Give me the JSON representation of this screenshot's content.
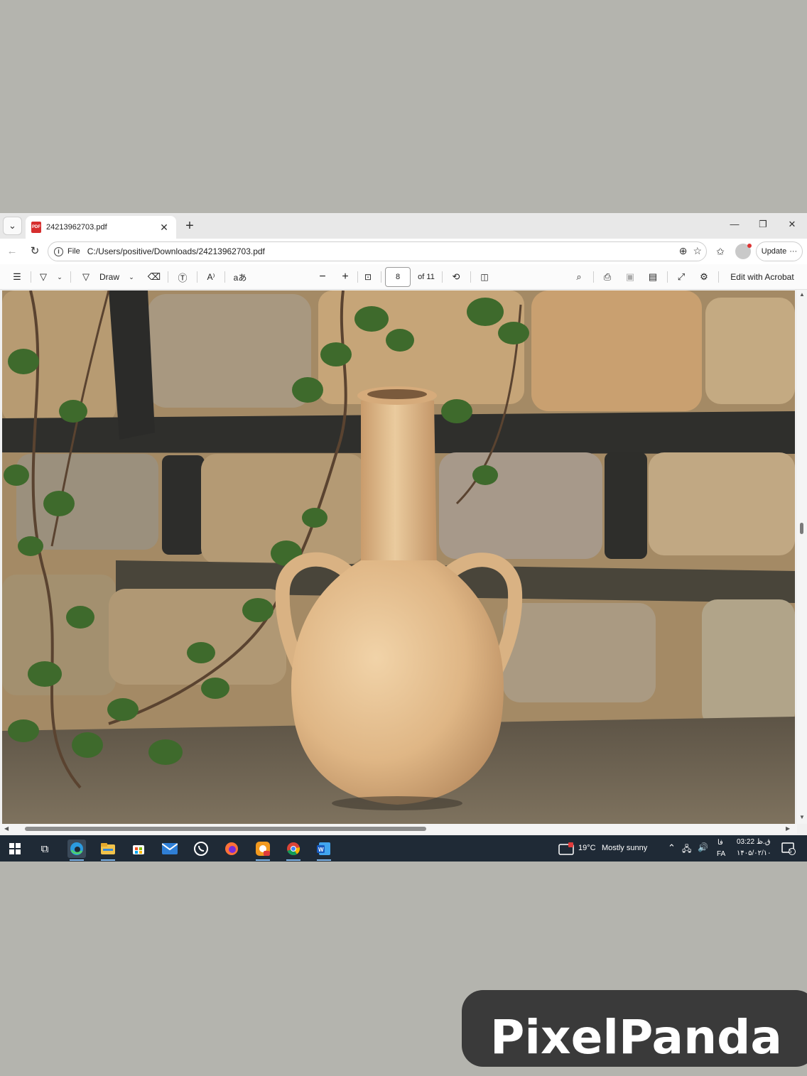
{
  "tab": {
    "title": "24213962703.pdf",
    "close": "✕"
  },
  "new_tab": "+",
  "window_controls": {
    "minimize": "—",
    "restore": "❐",
    "close": "✕"
  },
  "address": {
    "scheme": "File",
    "url": "C:/Users/positive/Downloads/24213962703.pdf"
  },
  "update_button": {
    "label": "Update"
  },
  "pdf_toolbar": {
    "draw_label": "Draw",
    "current_page": "8",
    "page_total": "of 11",
    "read_aloud_label": "aあ",
    "edit_acrobat": "Edit with Acrobat"
  },
  "document": {
    "subject": "terracotta amphora leaning against old stone wall with ivy",
    "colors": {
      "wall": "#b99a6e",
      "mortar": "#2f2f2c",
      "vase": "#e2bb8e",
      "ground": "#6f6452",
      "leaf": "#3e6a2c"
    }
  },
  "taskbar": {
    "weather_temp": "19°C",
    "weather_desc": "Mostly sunny",
    "lang_top": "فا",
    "lang_bottom": "FA",
    "time": "03:22 ق.ظ",
    "date": "۱۴۰۵/۰۲/۱۰",
    "notification_count": "5",
    "pinned_apps": [
      "start",
      "task-view",
      "edge",
      "file-explorer",
      "store",
      "mail",
      "whatsapp",
      "firefox",
      "photo-app",
      "chrome",
      "word"
    ]
  },
  "watermark": {
    "text": "PixelPanda"
  }
}
